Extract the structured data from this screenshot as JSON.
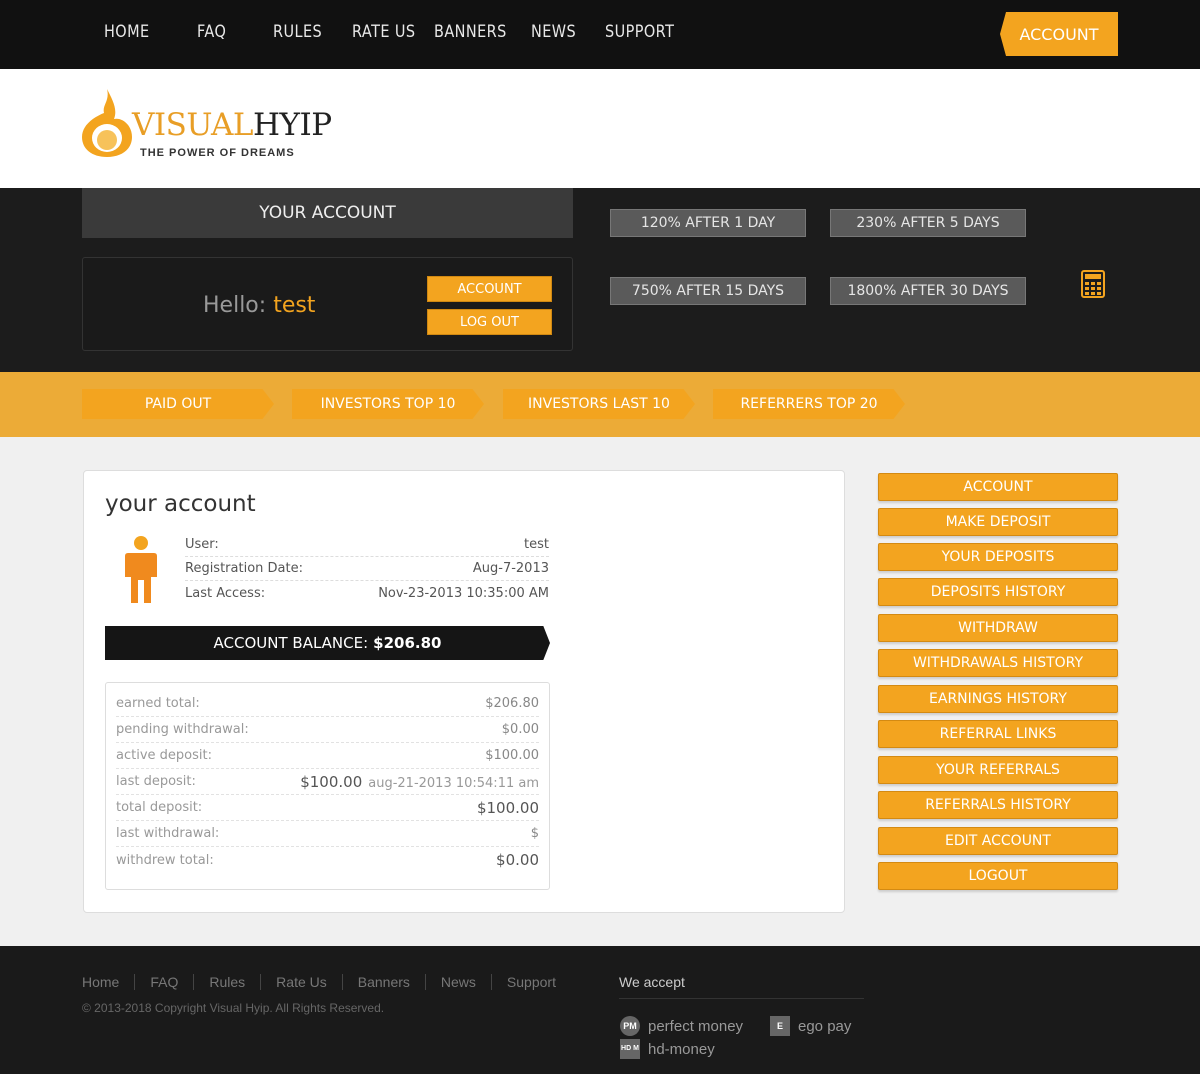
{
  "nav": {
    "items": [
      "HOME",
      "FAQ",
      "RULES",
      "RATE US",
      "BANNERS",
      "NEWS",
      "SUPPORT"
    ],
    "account_label": "ACCOUNT"
  },
  "logo": {
    "name_part1": "VISUAL",
    "name_part2": "HYIP",
    "tagline": "THE POWER OF DREAMS"
  },
  "account_box": {
    "heading": "YOUR ACCOUNT",
    "hello_prefix": "Hello:",
    "username": "test",
    "account_btn": "ACCOUNT",
    "logout_btn": "LOG OUT"
  },
  "plans": [
    "120% AFTER 1 DAY",
    "230% AFTER 5 DAYS",
    "750% AFTER 15 DAYS",
    "1800% AFTER 30 DAYS"
  ],
  "stat_tabs": [
    "PAID OUT",
    "INVESTORS TOP 10",
    "INVESTORS LAST 10",
    "REFERRERS TOP 20"
  ],
  "panel": {
    "title": "your account",
    "info": [
      {
        "label": "User:",
        "value": "test"
      },
      {
        "label": "Registration Date:",
        "value": "Aug-7-2013"
      },
      {
        "label": "Last Access:",
        "value": "Nov-23-2013 10:35:00 AM"
      }
    ],
    "balance_label": "ACCOUNT BALANCE:",
    "balance_value": "$206.80",
    "stats": [
      {
        "label": "earned total:",
        "value": "$206.80",
        "date": ""
      },
      {
        "label": "pending withdrawal:",
        "value": "$0.00",
        "date": ""
      },
      {
        "label": "active deposit:",
        "value": "$100.00",
        "date": ""
      },
      {
        "label": "last deposit:",
        "value": "$100.00",
        "date": "aug-21-2013 10:54:11 am"
      },
      {
        "label": "total deposit:",
        "value": "$100.00",
        "date": ""
      },
      {
        "label": "last withdrawal:",
        "value": "$",
        "date": ""
      },
      {
        "label": "withdrew total:",
        "value": "$0.00",
        "date": ""
      }
    ]
  },
  "side_menu": [
    "ACCOUNT",
    "MAKE DEPOSIT",
    "YOUR DEPOSITS",
    "DEPOSITS HISTORY",
    "WITHDRAW",
    "WITHDRAWALS HISTORY",
    "EARNINGS HISTORY",
    "REFERRAL LINKS",
    "YOUR REFERRALS",
    "REFERRALS HISTORY",
    "EDIT ACCOUNT",
    "LOGOUT"
  ],
  "footer": {
    "nav": [
      "Home",
      "FAQ",
      "Rules",
      "Rate Us",
      "Banners",
      "News",
      "Support"
    ],
    "copyright": "© 2013-2018 Copyright Visual Hyip. All Rights Reserved.",
    "we_accept": "We accept",
    "payments": [
      {
        "badge": "PM",
        "name": "perfect money"
      },
      {
        "badge": "E",
        "name": "ego pay"
      },
      {
        "badge": "HD M",
        "name": "hd-money"
      }
    ]
  },
  "colors": {
    "accent": "#f3a41f",
    "dark": "#1a1a1a"
  }
}
